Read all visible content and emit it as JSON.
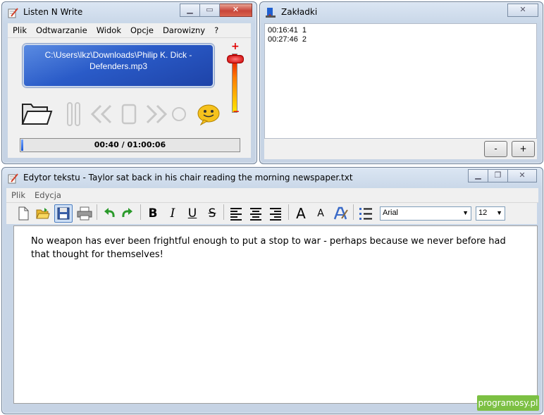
{
  "player": {
    "title": "Listen N Write",
    "menu": [
      "Plik",
      "Odtwarzanie",
      "Widok",
      "Opcje",
      "Darowizny",
      "?"
    ],
    "file_line1": "C:\\Users\\lkz\\Downloads\\Philip K. Dick -",
    "file_line2": "Defenders.mp3",
    "volume_plus": "+",
    "volume_minus": "−",
    "time": "00:40 / 01:00:06",
    "progress_fraction": 0.01
  },
  "bookmarks": {
    "title": "Zakładki",
    "items": [
      "00:16:41  1",
      "00:27:46  2"
    ],
    "remove_label": "-",
    "add_label": "+"
  },
  "editor": {
    "title": "Edytor tekstu - Taylor sat back in his chair reading the morning newspaper.txt",
    "menu": [
      "Plik",
      "Edycja"
    ],
    "font": "Arial",
    "size": "12",
    "bold": "B",
    "italic": "I",
    "underline": "U",
    "strike": "S",
    "grow": "A",
    "shrink": "A",
    "text": "No weapon has ever been frightful enough to put a stop to war - perhaps because we never before had that thought for themselves!"
  },
  "watermark": "programosy.pl",
  "colors": {
    "title_bar": "#c9d7e8",
    "lcd": "#2a5bc8",
    "close": "#c8453a",
    "watermark": "#7cc043"
  }
}
